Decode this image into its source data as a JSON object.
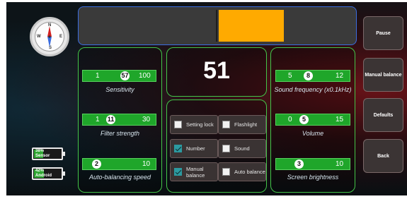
{
  "meter": {
    "fill_fraction_start": 0.505,
    "fill_fraction_end": 0.74,
    "fill_color": "#ffaa00"
  },
  "compass": {
    "north": "N",
    "east": "E",
    "south": "S",
    "west": "W"
  },
  "batteries": [
    {
      "percent": "38%",
      "label": "Sensor",
      "level": 0.38
    },
    {
      "percent": "42%",
      "label": "Android",
      "level": 0.42
    }
  ],
  "left_panel": {
    "sensitivity": {
      "min": "1",
      "value": "57",
      "max": "100",
      "caption": "Sensitivity"
    },
    "filter": {
      "min": "1",
      "value": "11",
      "max": "30",
      "caption": "Filter strength"
    },
    "auto_balancing": {
      "value": "2",
      "max": "10",
      "caption": "Auto-balancing speed"
    }
  },
  "reading": {
    "value": "51"
  },
  "options": {
    "setting_lock": {
      "label": "Setting lock",
      "checked": false
    },
    "flashlight": {
      "label": "Flashlight",
      "checked": false
    },
    "number": {
      "label": "Number",
      "checked": true
    },
    "sound": {
      "label": "Sound",
      "checked": false
    },
    "manual_balance": {
      "label": "Manual balance",
      "checked": true
    },
    "auto_balance": {
      "label": "Auto balance",
      "checked": false
    }
  },
  "right_panel": {
    "sound_frequency": {
      "min": "5",
      "value": "8",
      "max": "12",
      "caption": "Sound frequency (x0.1kHz)"
    },
    "volume": {
      "min": "0",
      "value": "5",
      "max": "15",
      "caption": "Volume"
    },
    "screen_brightness": {
      "value": "3",
      "max": "10",
      "caption": "Screen brightness"
    }
  },
  "side_buttons": {
    "pause": "Pause",
    "manual_balance": "Manual balance",
    "defaults": "Defaults",
    "back": "Back"
  },
  "colors": {
    "accent_green": "#1fa62a",
    "panel_border": "#43c548",
    "meter_border": "#3a6de0"
  }
}
